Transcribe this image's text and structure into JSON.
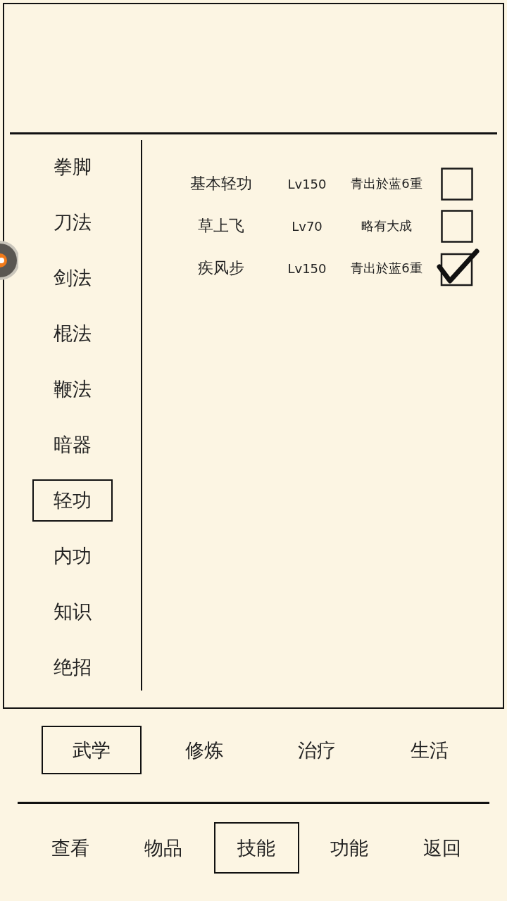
{
  "categories": [
    {
      "label": "拳脚",
      "selected": false
    },
    {
      "label": "刀法",
      "selected": false
    },
    {
      "label": "剑法",
      "selected": false
    },
    {
      "label": "棍法",
      "selected": false
    },
    {
      "label": "鞭法",
      "selected": false
    },
    {
      "label": "暗器",
      "selected": false
    },
    {
      "label": "轻功",
      "selected": true
    },
    {
      "label": "内功",
      "selected": false
    },
    {
      "label": "知识",
      "selected": false
    },
    {
      "label": "绝招",
      "selected": false
    }
  ],
  "skills": [
    {
      "name": "基本轻功",
      "level_text": "Lv150",
      "grade": "青出於蓝6重",
      "checked": false
    },
    {
      "name": "草上飞",
      "level_text": "Lv70",
      "grade": "略有大成",
      "checked": false
    },
    {
      "name": "疾风步",
      "level_text": "Lv150",
      "grade": "青出於蓝6重",
      "checked": true
    }
  ],
  "sub_tabs": [
    {
      "label": "武学",
      "selected": true
    },
    {
      "label": "修炼",
      "selected": false
    },
    {
      "label": "治疗",
      "selected": false
    },
    {
      "label": "生活",
      "selected": false
    }
  ],
  "bottom_nav": [
    {
      "label": "查看",
      "selected": false
    },
    {
      "label": "物品",
      "selected": false
    },
    {
      "label": "技能",
      "selected": true
    },
    {
      "label": "功能",
      "selected": false
    },
    {
      "label": "返回",
      "selected": false
    }
  ]
}
